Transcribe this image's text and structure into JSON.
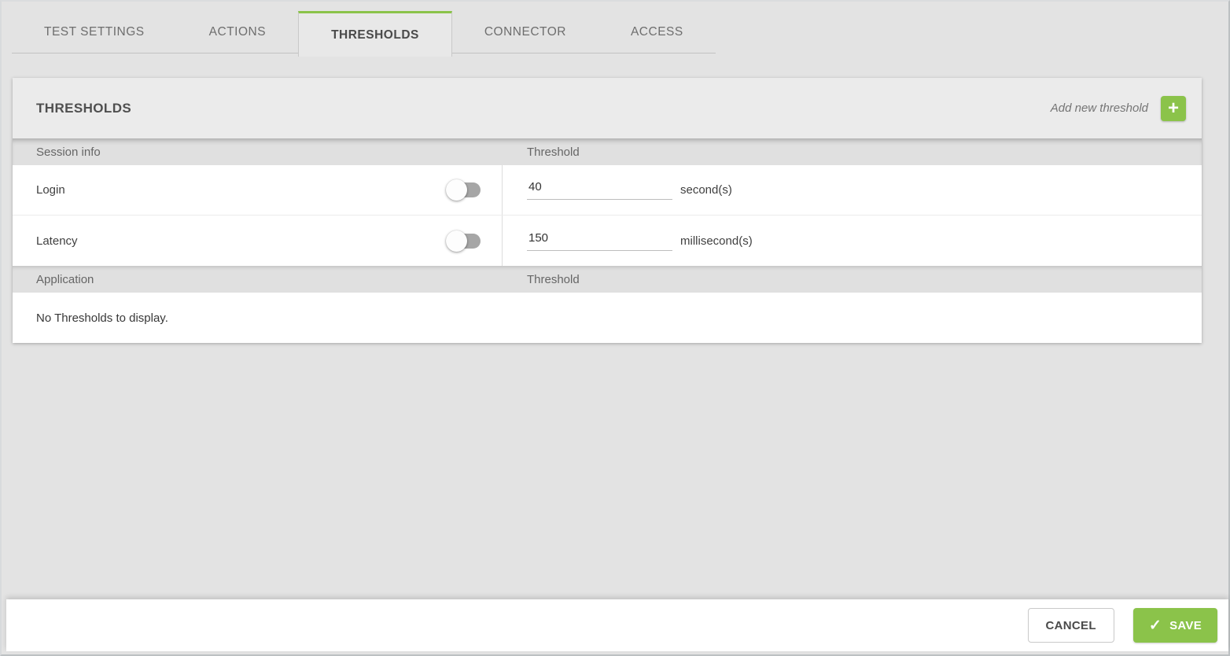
{
  "tabs": [
    {
      "label": "TEST SETTINGS",
      "active": false
    },
    {
      "label": "ACTIONS",
      "active": false
    },
    {
      "label": "THRESHOLDS",
      "active": true
    },
    {
      "label": "CONNECTOR",
      "active": false
    },
    {
      "label": "ACCESS",
      "active": false
    }
  ],
  "panel": {
    "title": "THRESHOLDS",
    "add_label": "Add new threshold",
    "sections": [
      {
        "header": {
          "col1": "Session info",
          "col2": "Threshold"
        },
        "rows": [
          {
            "label": "Login",
            "toggle_on": false,
            "value": "40",
            "unit": "second(s)"
          },
          {
            "label": "Latency",
            "toggle_on": false,
            "value": "150",
            "unit": "millisecond(s)"
          }
        ]
      },
      {
        "header": {
          "col1": "Application",
          "col2": "Threshold"
        },
        "empty_text": "No Thresholds to display."
      }
    ]
  },
  "footer": {
    "cancel_label": "CANCEL",
    "save_label": "SAVE"
  },
  "icons": {
    "plus": "+",
    "check": "✓"
  },
  "colors": {
    "accent_green": "#8BC34A",
    "page_background": "#e3e3e3",
    "card_header_background": "#ebebeb",
    "section_header_background": "#e0e0e0",
    "toggle_track_off": "#a6a6a6"
  }
}
